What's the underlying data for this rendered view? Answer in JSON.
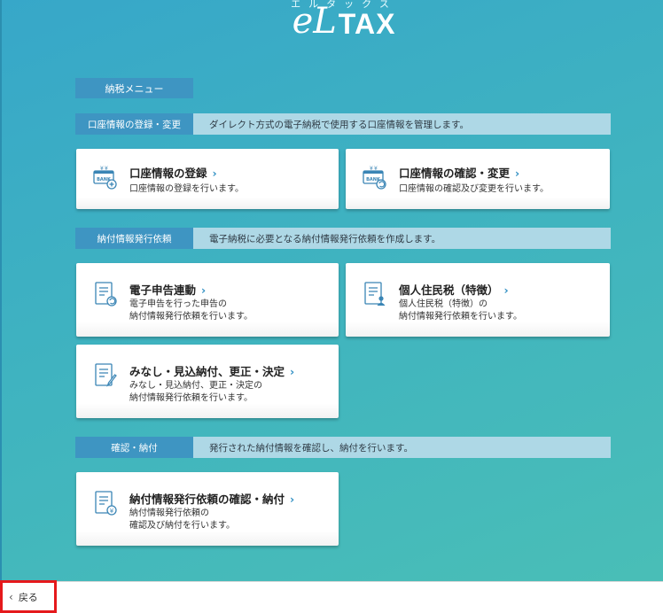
{
  "logo": {
    "ruby": "エルタックス",
    "el": "eL",
    "tax": "TAX"
  },
  "menu_title": "納税メニュー",
  "sections": [
    {
      "tag": "口座情報の登録・変更",
      "desc": "ダイレクト方式の電子納税で使用する口座情報を管理します。"
    },
    {
      "tag": "納付情報発行依頼",
      "desc": "電子納税に必要となる納付情報発行依頼を作成します。"
    },
    {
      "tag": "確認・納付",
      "desc": "発行された納付情報を確認し、納付を行います。"
    }
  ],
  "cards": {
    "account_register": {
      "title": "口座情報の登録",
      "desc1": "口座情報の登録を行います。"
    },
    "account_confirm": {
      "title": "口座情報の確認・変更",
      "desc1": "口座情報の確認及び変更を行います。"
    },
    "e_filing": {
      "title": "電子申告連動",
      "desc1": "電子申告を行った申告の",
      "desc2": "納付情報発行依頼を行います。"
    },
    "resident_tax": {
      "title": "個人住民税（特徴）",
      "desc1": "個人住民税（特徴）の",
      "desc2": "納付情報発行依頼を行います。"
    },
    "deemed_payment": {
      "title": "みなし・見込納付、更正・決定",
      "desc1": "みなし・見込納付、更正・決定の",
      "desc2": "納付情報発行依頼を行います。"
    },
    "confirm_payment": {
      "title": "納付情報発行依頼の確認・納付",
      "desc1": "納付情報発行依頼の",
      "desc2": "確認及び納付を行います。"
    }
  },
  "back_label": "戻る",
  "icons": {
    "bank_register": "bank-card-plus-icon",
    "bank_confirm": "bank-card-refresh-icon",
    "doc_refresh": "document-refresh-icon",
    "doc_person": "document-person-icon",
    "doc_pen": "document-pen-icon",
    "doc_yen": "document-yen-icon"
  },
  "colors": {
    "accent": "#3e95c2",
    "section_bg": "#aed8e6",
    "chevron": "#2f8fc3",
    "highlight": "#e5191c"
  }
}
